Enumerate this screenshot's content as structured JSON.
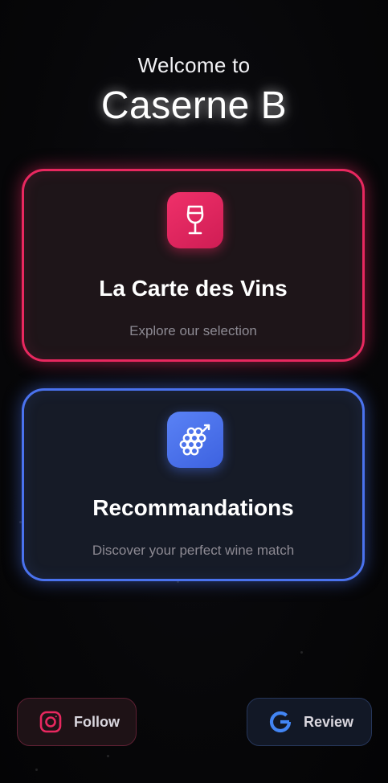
{
  "header": {
    "welcome": "Welcome to",
    "brand": "Caserne B"
  },
  "cards": {
    "wine_list": {
      "title": "La Carte des Vins",
      "subtitle": "Explore our selection",
      "icon": "wine-glass-icon",
      "accent": "#e8285f"
    },
    "recommendations": {
      "title": "Recommandations",
      "subtitle": "Discover your perfect wine match",
      "icon": "grapes-icon",
      "accent": "#4a72ee"
    }
  },
  "footer": {
    "follow": {
      "label": "Follow",
      "icon": "instagram-icon",
      "accent": "#e8285f"
    },
    "review": {
      "label": "Review",
      "icon": "google-icon",
      "accent": "#4285f4"
    }
  }
}
